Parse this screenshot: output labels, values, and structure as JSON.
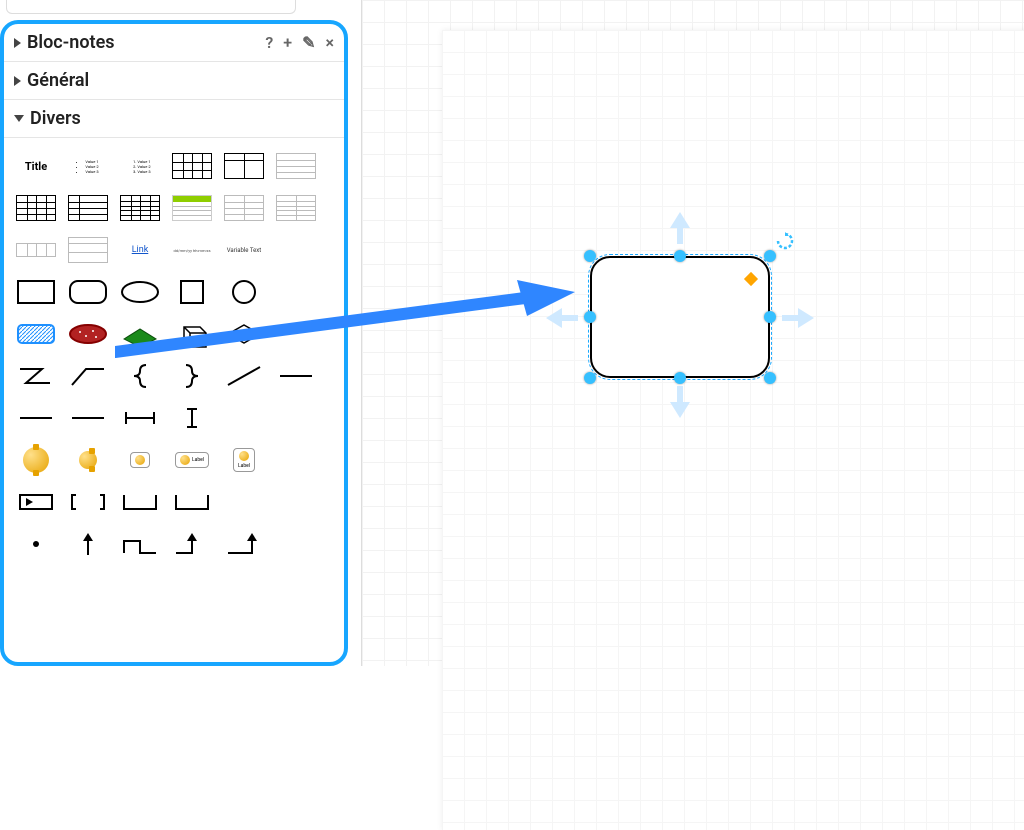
{
  "sidebar": {
    "sections": [
      {
        "title": "Bloc-notes",
        "open": false
      },
      {
        "title": "Général",
        "open": false
      },
      {
        "title": "Divers",
        "open": true
      }
    ],
    "tools": {
      "help": "?",
      "add": "+",
      "edit": "✎",
      "close": "×"
    },
    "shapes": {
      "title_text": "Title",
      "bullets": [
        "Value 1",
        "Value 2",
        "Value 3"
      ],
      "numbered": [
        "Value 1",
        "Value 2",
        "Value 3"
      ],
      "link_text": "Link",
      "timestamp_text": "dd/mm/yy hh:mm:ss",
      "variable_text": "Variable Text",
      "gear_label": "Label"
    }
  },
  "canvas": {
    "selected_shape": "rounded-rectangle"
  },
  "colors": {
    "accent": "#17a6ff",
    "arrow": "#2f86ff",
    "handle": "#36c0ff"
  }
}
